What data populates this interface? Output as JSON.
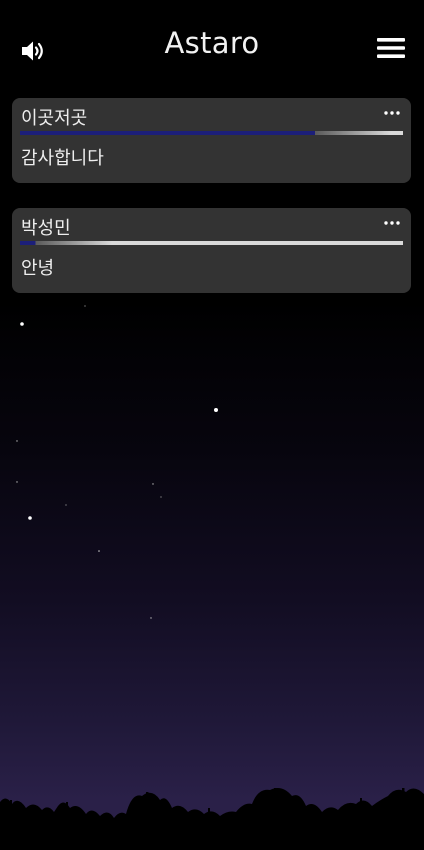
{
  "header": {
    "title": "Astaro",
    "sound_icon": "speaker-volume-icon",
    "menu_icon": "hamburger-menu-icon"
  },
  "posts": [
    {
      "name": "이곳저곳",
      "message": "감사합니다",
      "progress": 0.77,
      "more_icon": "more-horizontal-icon"
    },
    {
      "name": "박성민",
      "message": "안녕",
      "progress": 0.04,
      "more_icon": "more-horizontal-icon"
    }
  ],
  "colors": {
    "card_background": "#333333",
    "progress_fill": "#1c1f7a",
    "progress_track": "#d9d9d9",
    "sky_bottom": "#2b2149"
  }
}
